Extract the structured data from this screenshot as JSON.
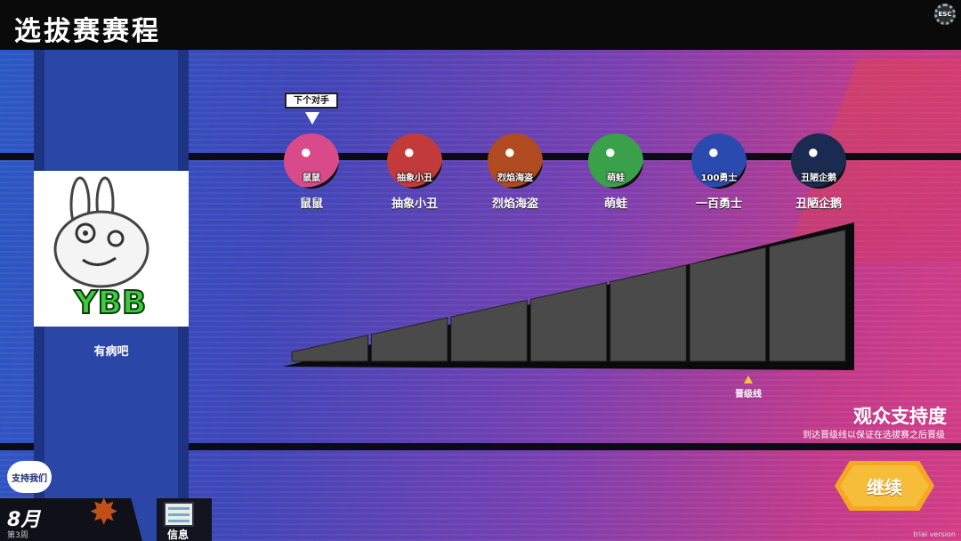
{
  "header": {
    "title": "选拔赛赛程",
    "esc_label": "ESC"
  },
  "player": {
    "logo_text": "YBB",
    "name": "有病吧"
  },
  "next_opponent_label": "下个对手",
  "opponents": [
    {
      "name": "鼠鼠",
      "badge": "鼠鼠",
      "color": "#d84a8a"
    },
    {
      "name": "抽象小丑",
      "badge": "抽象小丑",
      "color": "#c23a3a"
    },
    {
      "name": "烈焰海盗",
      "badge": "烈焰海盗",
      "color": "#b04a20"
    },
    {
      "name": "萌蛙",
      "badge": "萌蛙",
      "color": "#3aa04a"
    },
    {
      "name": "一百勇士",
      "badge": "100勇士",
      "color": "#2a4ab0"
    },
    {
      "name": "丑陋企鹅",
      "badge": "丑陋企鹅",
      "color": "#1a2a50"
    }
  ],
  "audience": {
    "title": "观众支持度",
    "subtitle": "到达晋级线以保证在选拔赛之后晋级",
    "qualify_label": "晋级线",
    "segments": 7,
    "filled_segments": 0,
    "qualify_segment": 6
  },
  "continue_label": "继续",
  "trial_label": "trial version",
  "support_us_label": "支持我们",
  "date": {
    "month": "8月",
    "week": "第3周"
  },
  "info_label": "信息",
  "colors": {
    "accent": "#f6bd3b",
    "bar_segment": "#4a4a4a"
  }
}
